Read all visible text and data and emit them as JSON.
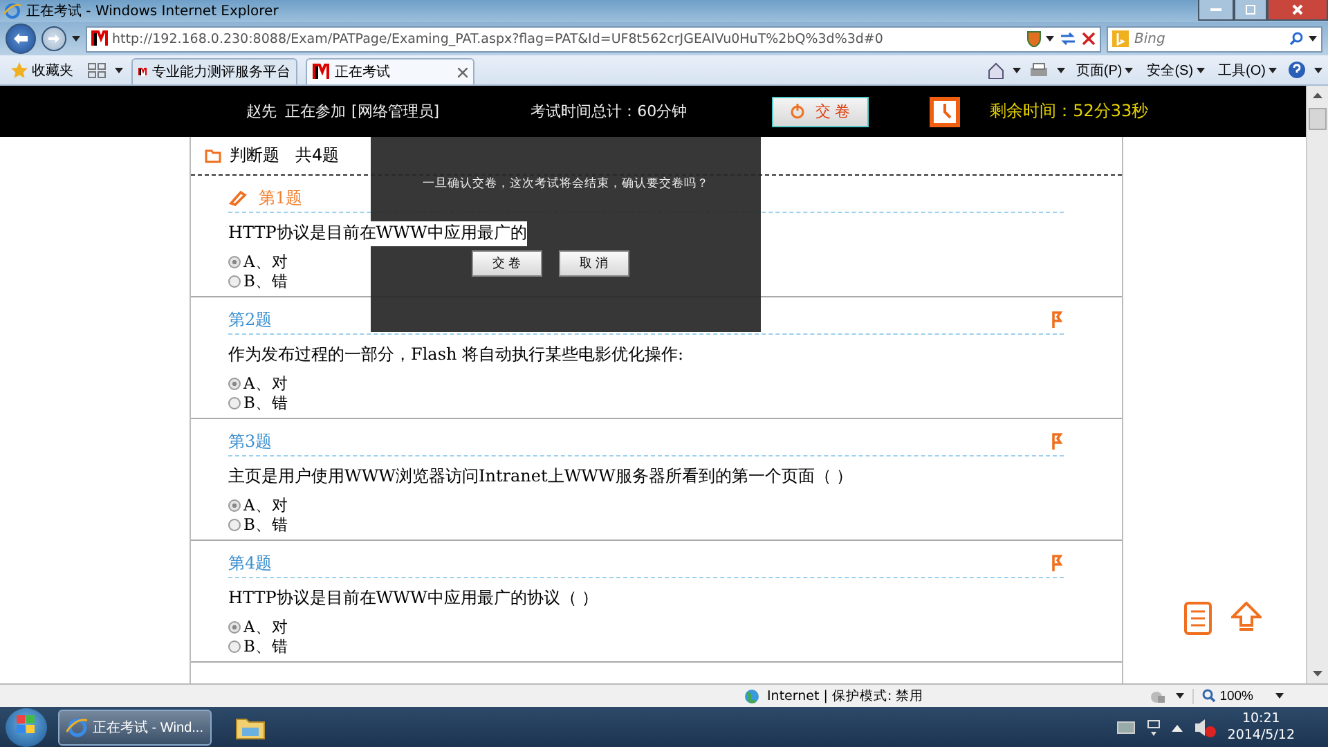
{
  "window": {
    "title": "正在考试 - Windows Internet Explorer"
  },
  "browser": {
    "url": "http://192.168.0.230:8088/Exam/PATPage/Examing_PAT.aspx?flag=PAT&Id=UF8t562crJGEAIVu0HuT%2bQ%3d%3d#0",
    "search_placeholder": "Bing",
    "favorites": "收藏夹",
    "tabs": [
      {
        "label": "专业能力测评服务平台",
        "selected": false
      },
      {
        "label": "正在考试",
        "selected": true
      }
    ],
    "commands": [
      "页面(P)",
      "安全(S)",
      "工具(O)"
    ]
  },
  "exam_header": {
    "candidate": "赵先",
    "status": "正在参加",
    "exam": "[网络管理员]",
    "total_time": "考试时间总计：60分钟",
    "submit": "交 卷",
    "remaining": "剩余时间：52分33秒"
  },
  "section": {
    "title": "判断题   共4题"
  },
  "questions": [
    {
      "number": "第1题",
      "current": true,
      "text": "HTTP协议是目前在WWW中应用最广的",
      "options": [
        {
          "label": "A、对",
          "selected": true
        },
        {
          "label": "B、错",
          "selected": false
        }
      ]
    },
    {
      "number": "第2题",
      "current": false,
      "text": "作为发布过程的一部分，Flash 将自动执行某些电影优化操作:",
      "options": [
        {
          "label": "A、对",
          "selected": true
        },
        {
          "label": "B、错",
          "selected": false
        }
      ]
    },
    {
      "number": "第3题",
      "current": false,
      "text": "主页是用户使用WWW浏览器访问Intranet上WWW服务器所看到的第一个页面（  ）",
      "options": [
        {
          "label": "A、对",
          "selected": true
        },
        {
          "label": "B、错",
          "selected": false
        }
      ]
    },
    {
      "number": "第4题",
      "current": false,
      "text": "HTTP协议是目前在WWW中应用最广的协议（ ）",
      "options": [
        {
          "label": "A、对",
          "selected": true
        },
        {
          "label": "B、错",
          "selected": false
        }
      ]
    }
  ],
  "dialog": {
    "message": "一旦确认交卷，这次考试将会结束，确认要交卷吗？",
    "buttons": [
      "交 卷",
      "取 消"
    ]
  },
  "status_bar": {
    "zone": "Internet | 保护模式: 禁用",
    "zoom": "100%"
  },
  "taskbar": {
    "window": "正在考试 - Wind...",
    "time": "10:21",
    "date": "2014/5/12"
  }
}
